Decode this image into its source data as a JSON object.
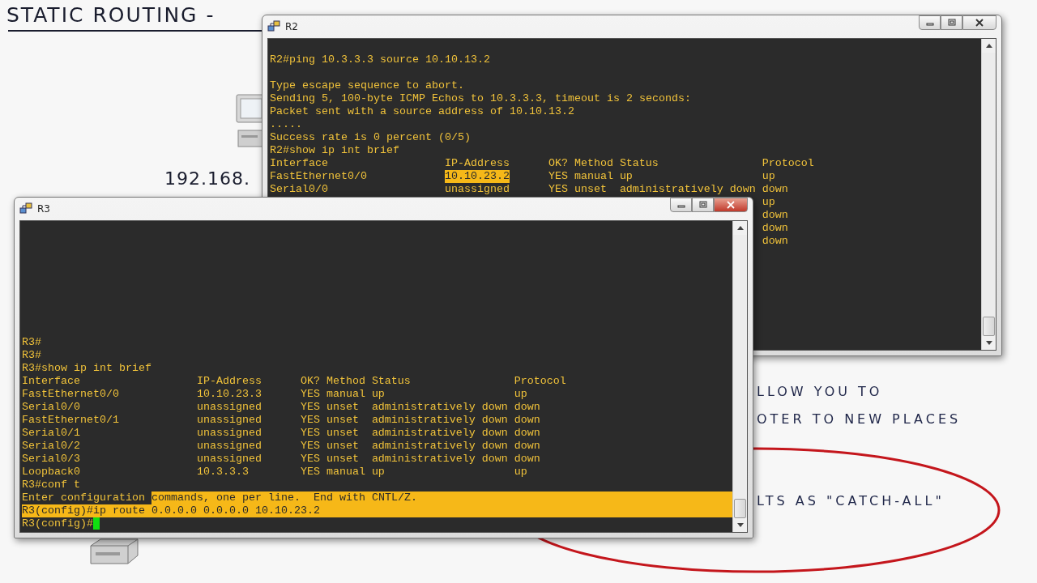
{
  "whiteboard": {
    "title": "STATIC ROUTING -",
    "address": "192.168.",
    "notes": [
      "LLOW YOU TO",
      "OTER TO NEW PLACES",
      "LTS AS \"CATCH-ALL\""
    ]
  },
  "windows": [
    {
      "title": "R2",
      "active": false,
      "lines_before": [
        {
          "kind": "blank"
        },
        {
          "kind": "text",
          "segments": [
            {
              "text": "R2#ping 10.3.3.3 source 10.10.13.2",
              "selected": false
            }
          ]
        },
        {
          "kind": "blank"
        },
        {
          "kind": "text",
          "segments": [
            {
              "text": "Type escape sequence to abort.",
              "selected": false
            }
          ]
        },
        {
          "kind": "text",
          "segments": [
            {
              "text": "Sending 5, 100-byte ICMP Echos to 10.3.3.3, timeout is 2 seconds:",
              "selected": false
            }
          ]
        },
        {
          "kind": "text",
          "segments": [
            {
              "text": "Packet sent with a source address of 10.10.13.2",
              "selected": false
            }
          ]
        },
        {
          "kind": "text",
          "segments": [
            {
              "text": ".....",
              "selected": false
            }
          ]
        },
        {
          "kind": "text",
          "segments": [
            {
              "text": "Success rate is 0 percent (0/5)",
              "selected": false
            }
          ]
        },
        {
          "kind": "text",
          "segments": [
            {
              "text": "R2#show ip int brief",
              "selected": false
            }
          ]
        }
      ],
      "table": {
        "header": {
          "interface": "Interface",
          "ip_address": "IP-Address",
          "ok": "OK?",
          "method": "Method",
          "status": "Status",
          "protocol": "Protocol"
        },
        "rows": [
          {
            "interface": "FastEthernet0/0",
            "ip_address": "10.10.23.2",
            "ip_selected": true,
            "ok": "YES",
            "method": "manual",
            "status": "up",
            "protocol": "up"
          },
          {
            "interface": "Serial0/0",
            "ip_address": "unassigned",
            "ip_selected": false,
            "ok": "YES",
            "method": "unset",
            "status": "administratively down",
            "protocol": "down"
          },
          {
            "protocol": "up"
          },
          {
            "protocol": "down"
          },
          {
            "protocol": "down"
          },
          {
            "protocol": "down"
          }
        ]
      }
    },
    {
      "title": "R3",
      "active": true,
      "cursor": true,
      "lines_before": [
        {
          "kind": "text",
          "segments": [
            {
              "text": "R3#",
              "selected": false
            }
          ]
        },
        {
          "kind": "text",
          "segments": [
            {
              "text": "R3#",
              "selected": false
            }
          ]
        },
        {
          "kind": "text",
          "segments": [
            {
              "text": "R3#show ip int brief",
              "selected": false
            }
          ]
        }
      ],
      "table": {
        "header": {
          "interface": "Interface",
          "ip_address": "IP-Address",
          "ok": "OK?",
          "method": "Method",
          "status": "Status",
          "protocol": "Protocol"
        },
        "rows": [
          {
            "interface": "FastEthernet0/0",
            "ip_address": "10.10.23.3",
            "ip_selected": false,
            "ok": "YES",
            "method": "manual",
            "status": "up",
            "protocol": "up"
          },
          {
            "interface": "Serial0/0",
            "ip_address": "unassigned",
            "ip_selected": false,
            "ok": "YES",
            "method": "unset",
            "status": "administratively down",
            "protocol": "down"
          },
          {
            "interface": "FastEthernet0/1",
            "ip_address": "unassigned",
            "ip_selected": false,
            "ok": "YES",
            "method": "unset",
            "status": "administratively down",
            "protocol": "down"
          },
          {
            "interface": "Serial0/1",
            "ip_address": "unassigned",
            "ip_selected": false,
            "ok": "YES",
            "method": "unset",
            "status": "administratively down",
            "protocol": "down"
          },
          {
            "interface": "Serial0/2",
            "ip_address": "unassigned",
            "ip_selected": false,
            "ok": "YES",
            "method": "unset",
            "status": "administratively down",
            "protocol": "down"
          },
          {
            "interface": "Serial0/3",
            "ip_address": "unassigned",
            "ip_selected": false,
            "ok": "YES",
            "method": "unset",
            "status": "administratively down",
            "protocol": "down"
          },
          {
            "interface": "Loopback0",
            "ip_address": "10.3.3.3",
            "ip_selected": false,
            "ok": "YES",
            "method": "manual",
            "status": "up",
            "protocol": "up"
          }
        ]
      },
      "lines_after": [
        {
          "kind": "text",
          "segments": [
            {
              "text": "R3#conf t",
              "selected": false
            }
          ]
        },
        {
          "kind": "text",
          "segments": [
            {
              "text": "Enter configuration ",
              "selected": false
            },
            {
              "text": "commands, one per line.  End with CNTL/Z.",
              "selected": true
            }
          ]
        },
        {
          "kind": "text",
          "segments": [
            {
              "text": "R3(config)#ip route 0.0.0.0 0.0.0.0 10.10.23.2",
              "selected": true
            }
          ]
        },
        {
          "kind": "text",
          "segments": [
            {
              "text": "R3(config)#",
              "selected": false
            }
          ]
        }
      ]
    }
  ]
}
